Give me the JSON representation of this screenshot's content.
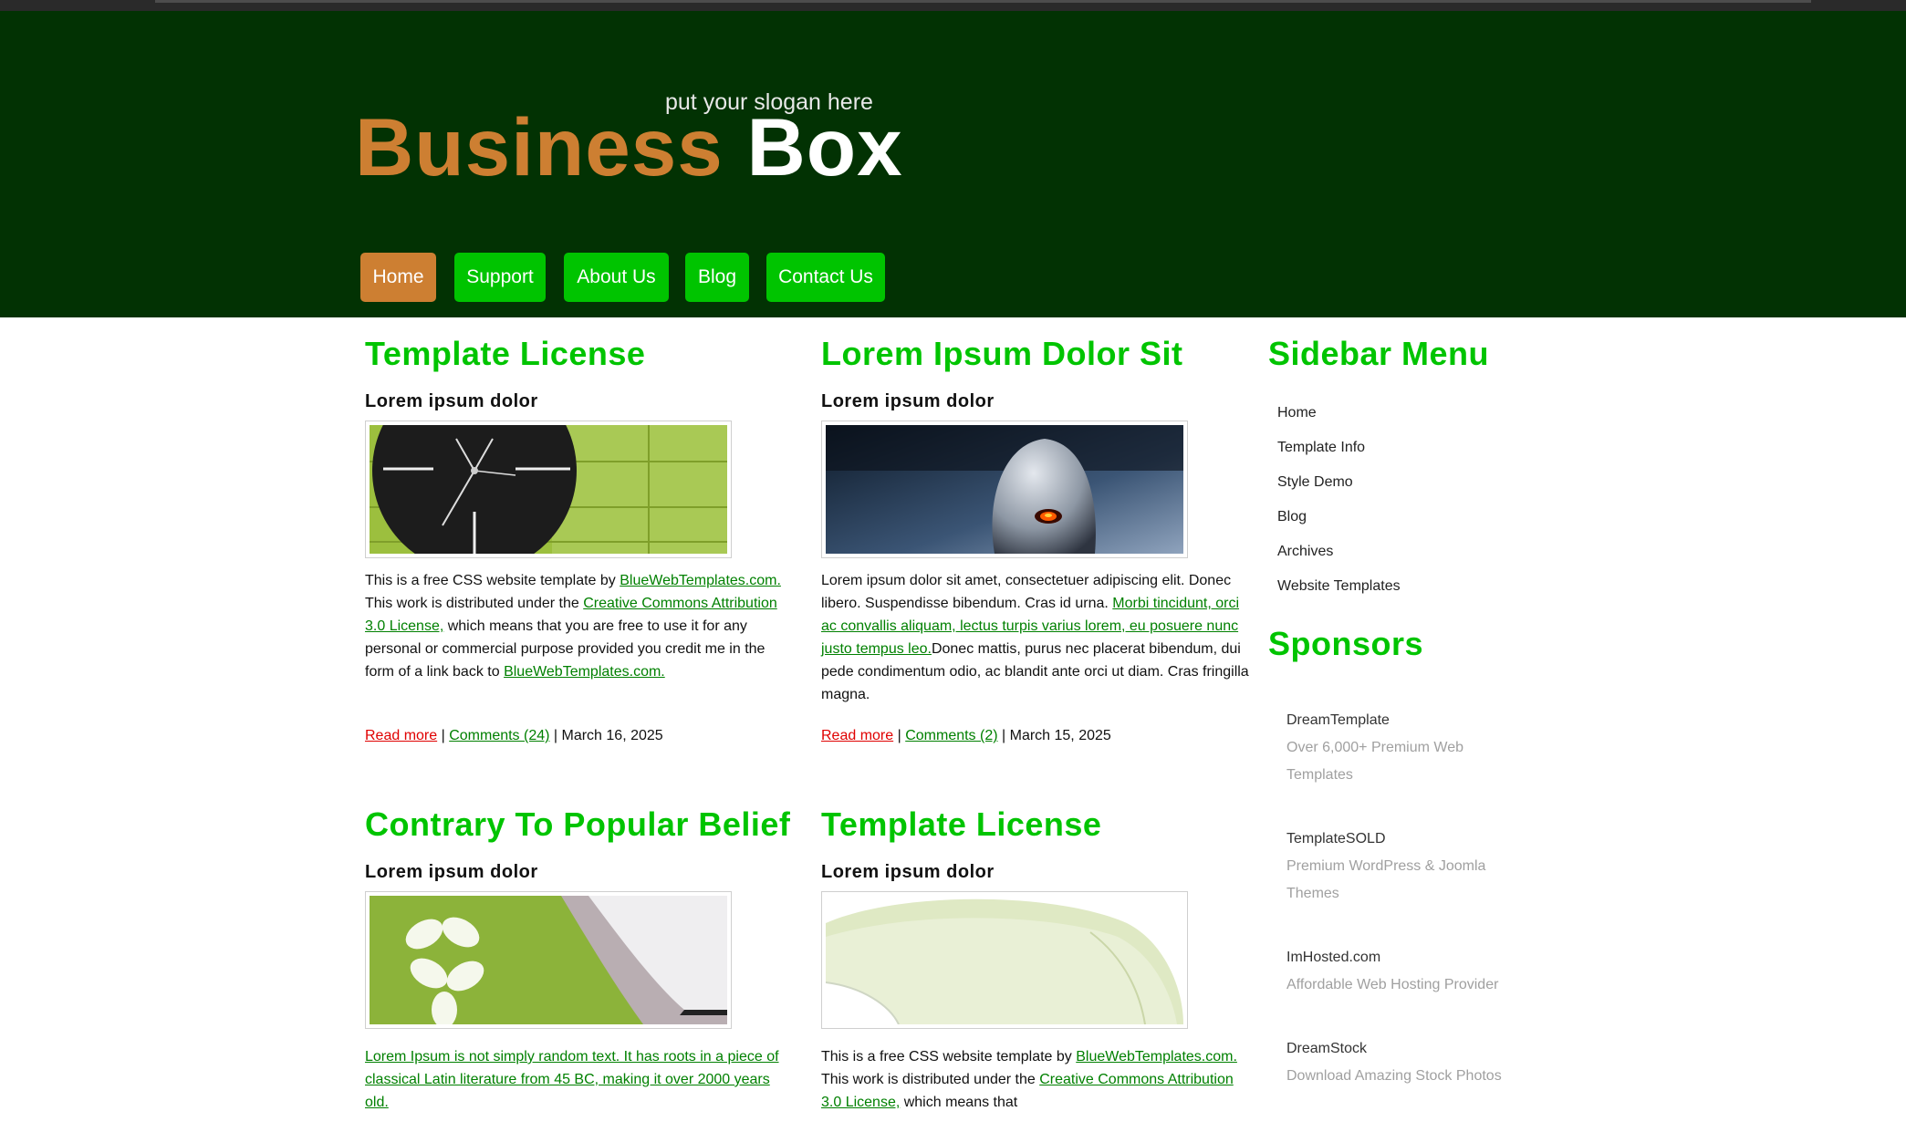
{
  "header": {
    "slogan": "put your slogan here",
    "logo_part1": "Business",
    "logo_part2": "Box"
  },
  "nav": {
    "items": [
      {
        "label": "Home",
        "active": true
      },
      {
        "label": "Support",
        "active": false
      },
      {
        "label": "About Us",
        "active": false
      },
      {
        "label": "Blog",
        "active": false
      },
      {
        "label": "Contact Us",
        "active": false
      }
    ]
  },
  "posts": [
    {
      "title": "Template License",
      "subtitle": "Lorem ipsum dolor",
      "image": "clock-image",
      "body": [
        {
          "text": "This is a free CSS website template by "
        },
        {
          "text": "BlueWebTemplates.com.",
          "link": true
        },
        {
          "text": " This work is distributed under the "
        },
        {
          "text": "Creative Commons Attribution 3.0 License,",
          "link": true
        },
        {
          "text": " which means that you are free to use it for any personal or commercial purpose provided you credit me in the form of a link back to "
        },
        {
          "text": "BlueWebTemplates.com.",
          "link": true
        }
      ],
      "read_more": "Read more",
      "comments": "Comments (24)",
      "date": "March 16, 2025"
    },
    {
      "title": "Lorem Ipsum Dolor Sit",
      "subtitle": "Lorem ipsum dolor",
      "image": "mouse-image",
      "body": [
        {
          "text": "Lorem ipsum dolor sit amet, consectetuer adipiscing elit. Donec libero. Suspendisse bibendum. Cras id urna. "
        },
        {
          "text": "Morbi tincidunt, orci ac convallis aliquam, lectus turpis varius lorem, eu posuere nunc justo tempus leo.",
          "link": true
        },
        {
          "text": "Donec mattis, purus nec placerat bibendum, dui pede condimentum odio, ac blandit ante orci ut diam. Cras fringilla magna."
        }
      ],
      "read_more": "Read more",
      "comments": "Comments (2)",
      "date": "March 15, 2025"
    },
    {
      "title": "Contrary To Popular Belief",
      "subtitle": "Lorem ipsum dolor",
      "image": "keyboard-image",
      "body": [
        {
          "text": "Lorem Ipsum is not simply random text. It has roots in a piece of classical Latin literature from 45 BC, making it over 2000 years old.",
          "link": true
        }
      ]
    },
    {
      "title": "Template License",
      "subtitle": "Lorem ipsum dolor",
      "image": "green-mouse-image",
      "body": [
        {
          "text": "This is a free CSS website template by "
        },
        {
          "text": "BlueWebTemplates.com.",
          "link": true
        },
        {
          "text": " This work is distributed under the "
        },
        {
          "text": "Creative Commons Attribution 3.0 License,",
          "link": true
        },
        {
          "text": " which means that"
        }
      ]
    }
  ],
  "sidebar": {
    "title": "Sidebar Menu",
    "menu": [
      "Home",
      "Template Info",
      "Style Demo",
      "Blog",
      "Archives",
      "Website Templates"
    ],
    "sponsors_title": "Sponsors",
    "sponsors": [
      {
        "name": "DreamTemplate",
        "desc": "Over 6,000+ Premium Web Templates"
      },
      {
        "name": "TemplateSOLD",
        "desc": "Premium WordPress & Joomla Themes"
      },
      {
        "name": "ImHosted.com",
        "desc": "Affordable Web Hosting Provider"
      },
      {
        "name": "DreamStock",
        "desc": "Download Amazing Stock Photos"
      }
    ]
  },
  "colors": {
    "header_bg": "#023203",
    "accent_green": "#00c400",
    "accent_orange": "#cd7f32",
    "link_green": "#008000",
    "link_red": "#e00000"
  }
}
